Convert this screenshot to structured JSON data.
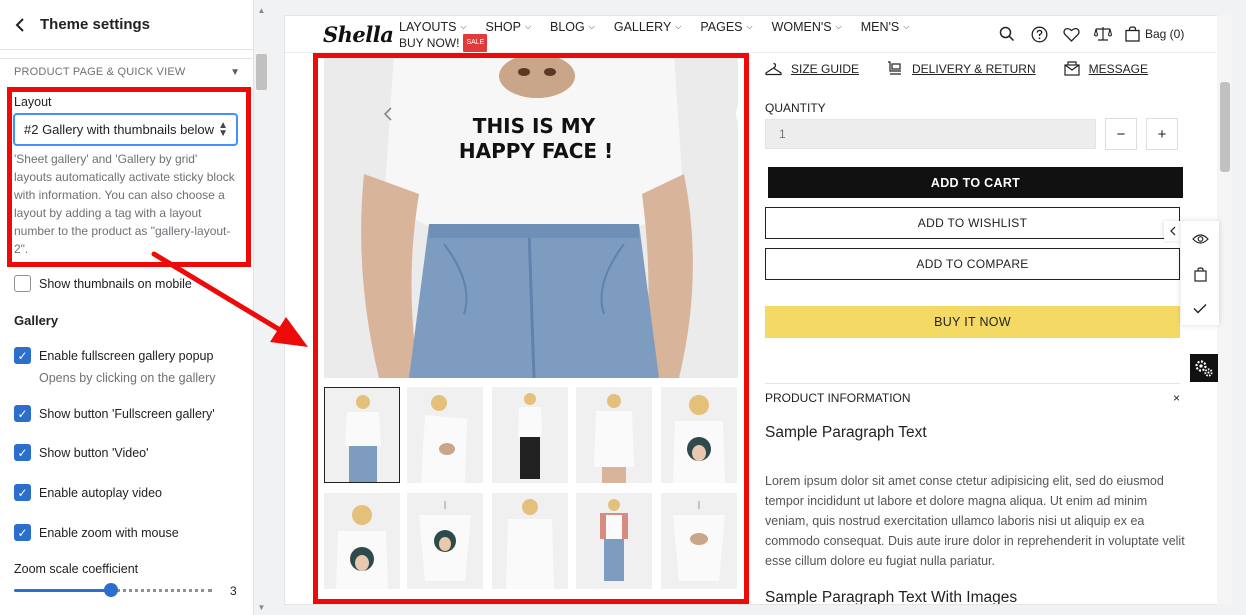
{
  "settings": {
    "back_icon": "chevron-left-icon",
    "title": "Theme settings",
    "section_title": "PRODUCT PAGE & QUICK VIEW",
    "layout_label": "Layout",
    "layout_value": "#2 Gallery with thumbnails below",
    "layout_help": "'Sheet gallery' and 'Gallery by grid' layouts automatically activate sticky block with information. You can also choose a layout by adding a tag with a layout number to the product as \"gallery-layout-2\".",
    "show_thumbnails_mobile": {
      "label": "Show thumbnails on mobile",
      "checked": false
    },
    "gallery_heading": "Gallery",
    "checks": [
      {
        "label": "Enable fullscreen gallery popup",
        "checked": true,
        "sub": "Opens by clicking on the gallery"
      },
      {
        "label": "Show button 'Fullscreen gallery'",
        "checked": true
      },
      {
        "label": "Show button 'Video'",
        "checked": true
      },
      {
        "label": "Enable autoplay video",
        "checked": true
      },
      {
        "label": "Enable zoom with mouse",
        "checked": true
      }
    ],
    "zoom_label": "Zoom scale coefficient",
    "zoom_value": "3"
  },
  "store": {
    "logo": "Shella",
    "nav": [
      "LAYOUTS",
      "SHOP",
      "BLOG",
      "GALLERY",
      "PAGES",
      "WOMEN'S",
      "MEN'S"
    ],
    "buy_now": "BUY NOW!",
    "sale_badge": "SALE",
    "bag": "Bag (0)",
    "header_icons": [
      "search-icon",
      "help-icon",
      "heart-icon",
      "compare-scale-icon",
      "bag-icon"
    ]
  },
  "product": {
    "links": [
      "SIZE GUIDE",
      "DELIVERY & RETURN",
      "MESSAGE"
    ],
    "quantity_label": "QUANTITY",
    "quantity_value": "1",
    "minus": "−",
    "plus": "+",
    "add_to_cart": "ADD TO CART",
    "add_to_wishlist": "ADD TO WISHLIST",
    "add_to_compare": "ADD TO COMPARE",
    "buy_it_now": "BUY IT NOW",
    "info_heading": "PRODUCT INFORMATION",
    "info_close": "×",
    "para_title": "Sample Paragraph Text",
    "lorem": "Lorem ipsum dolor sit amet conse ctetur adipisicing elit, sed do eiusmod tempor incididunt ut labore et dolore magna aliqua. Ut enim ad minim veniam, quis nostrud exercitation ullamco laboris nisi ut aliquip ex ea commodo consequat. Duis aute irure dolor in reprehenderit in voluptate velit esse cillum dolore eu fugiat nulla pariatur.",
    "para_title_2": "Sample Paragraph Text With Images",
    "main_image_text": [
      "THIS IS MY",
      "HAPPY FACE !"
    ]
  },
  "colors": {
    "highlight_red": "#ef0a0a",
    "checkbox_blue": "#2c6ecb",
    "buy_now_yellow": "#f4da65",
    "cart_black": "#111111"
  }
}
